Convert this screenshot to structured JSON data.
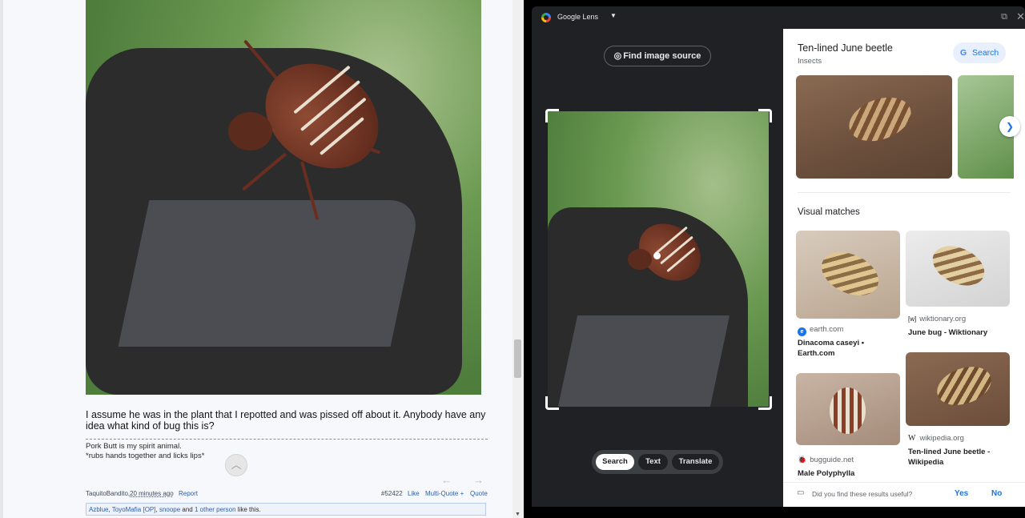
{
  "forum": {
    "post_text": "I assume he was in the plant that I repotted and was pissed off about it. Anybody have any idea what kind of bug this is?",
    "signature_line1": "Pork Butt is my spirit animal.",
    "signature_line2": "*rubs hands together and licks lips*",
    "author": "TaquitoBandito,",
    "time_ago": "20 minutes ago",
    "report": "Report",
    "post_number": "#52422",
    "like": "Like",
    "multi_quote": "Multi-Quote +",
    "quote": "Quote",
    "likes_bar": {
      "user1": "Azblue",
      "sep1": ",",
      "user2": "ToyoMafia [OP]",
      "sep2": ",",
      "user3": "snoope",
      "and": " and ",
      "others": "1 other person",
      "suffix": " like this."
    }
  },
  "lens": {
    "title": "Google Lens",
    "find_image_source": "Find image source",
    "modes": [
      "Search",
      "Text",
      "Translate"
    ],
    "active_mode": "Search",
    "result": {
      "title": "Ten-lined June beetle",
      "subtitle": "Insects",
      "search_label": "Search",
      "search_logo": "G"
    },
    "visual_matches_title": "Visual matches",
    "matches": [
      {
        "source": "earth.com",
        "caption": "Dinacoma caseyi • Earth.com",
        "icon": "e"
      },
      {
        "source": "wiktionary.org",
        "caption": "June bug - Wiktionary",
        "icon": "[w]"
      },
      {
        "source": "bugguide.net",
        "caption": "Male Polyphylla",
        "icon": "🐞"
      },
      {
        "source": "wikipedia.org",
        "caption": "Ten-lined June beetle - Wikipedia",
        "icon": "W"
      }
    ],
    "feedback_question": "Did you find these results useful?",
    "yes": "Yes",
    "no": "No"
  },
  "icons": {
    "find_source": "lens-search-icon",
    "next": "chevron-right-icon",
    "close": "close-icon",
    "open_in_new": "open-in-new-icon",
    "scroll_up": "chevron-up-icon",
    "feedback": "feedback-icon"
  },
  "colors": {
    "accent_blue": "#1a73e8",
    "lens_dark": "#202124",
    "forum_link": "#2c5ea8"
  }
}
